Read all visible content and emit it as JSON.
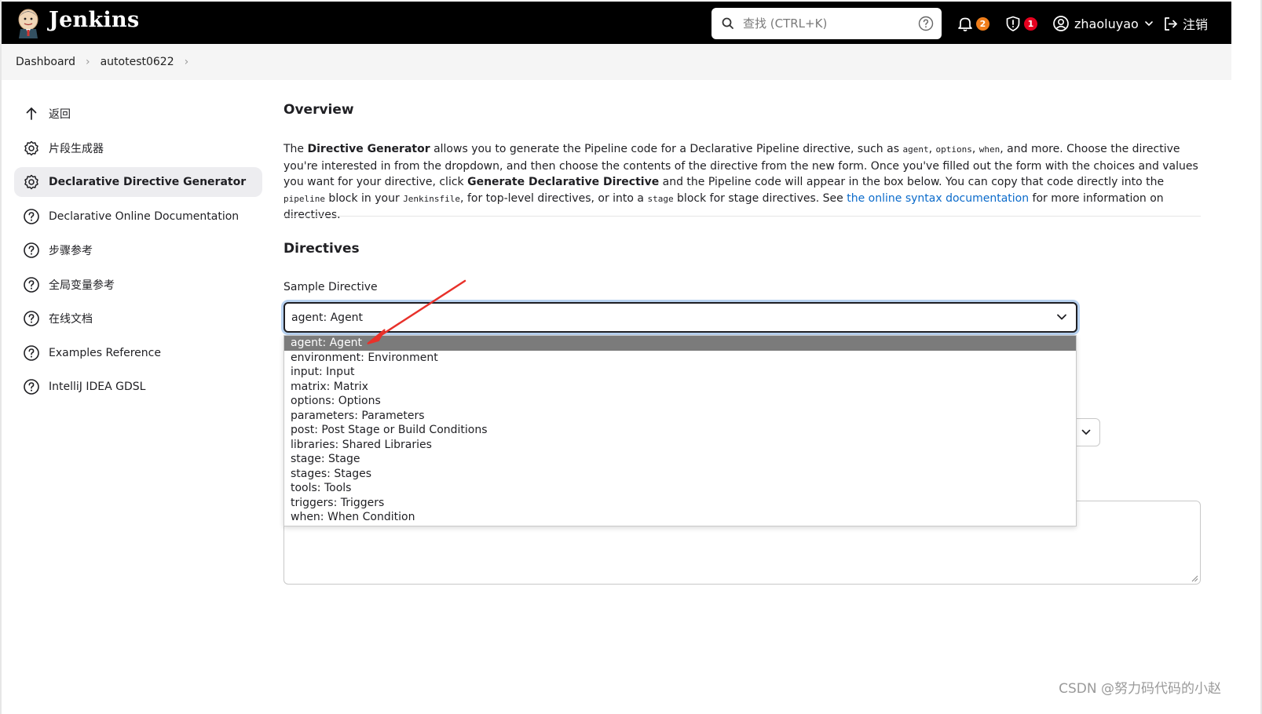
{
  "header": {
    "brand": "Jenkins",
    "search_placeholder": "查找 (CTRL+K)",
    "notifications_count": "2",
    "security_count": "1",
    "user": "zhaoluyao",
    "logout": "注销"
  },
  "breadcrumb": [
    "Dashboard",
    "autotest0622"
  ],
  "sidebar": {
    "items": [
      {
        "label": "返回",
        "icon": "arrow-up-icon"
      },
      {
        "label": "片段生成器",
        "icon": "gear-icon"
      },
      {
        "label": "Declarative Directive Generator",
        "icon": "gear-icon",
        "active": true
      },
      {
        "label": "Declarative Online Documentation",
        "icon": "help-icon"
      },
      {
        "label": "步骤参考",
        "icon": "help-icon"
      },
      {
        "label": "全局变量参考",
        "icon": "help-icon"
      },
      {
        "label": "在线文档",
        "icon": "help-icon"
      },
      {
        "label": "Examples Reference",
        "icon": "help-icon"
      },
      {
        "label": "IntelliJ IDEA GDSL",
        "icon": "help-icon"
      }
    ]
  },
  "overview": {
    "title": "Overview",
    "text_parts": {
      "p1": "The ",
      "b1": "Directive Generator",
      "p2": " allows you to generate the Pipeline code for a Declarative Pipeline directive, such as ",
      "c1": "agent",
      "p3": ", ",
      "c2": "options",
      "p4": ", ",
      "c3": "when",
      "p5": ", and more. Choose the directive you're interested in from the dropdown, and then choose the contents of the directive from the new form. Once you've filled out the form with the choices and values you want for your directive, click ",
      "b2": "Generate Declarative Directive",
      "p6": " and the Pipeline code will appear in the box below. You can copy that code directly into the ",
      "c4": "pipeline",
      "p7": " block in your ",
      "c5": "Jenkinsfile",
      "p8": ", for top-level directives, or into a ",
      "c6": "stage",
      "p9": " block for stage directives. See ",
      "link": "the online syntax documentation",
      "p10": " for more information on directives."
    }
  },
  "directives": {
    "title": "Directives",
    "field_label": "Sample Directive",
    "selected": "agent: Agent",
    "options": [
      "agent: Agent",
      "environment: Environment",
      "input: Input",
      "matrix: Matrix",
      "options: Options",
      "parameters: Parameters",
      "post: Post Stage or Build Conditions",
      "libraries: Shared Libraries",
      "stage: Stage",
      "stages: Stages",
      "tools: Tools",
      "triggers: Triggers",
      "when: When Condition"
    ]
  },
  "colors": {
    "header_bg": "#000000",
    "notif_badge": "#f07e1b",
    "security_badge": "#e6001f",
    "link": "#0b6bcb",
    "focus_ring": "#b8d2f0",
    "selected_option": "#7b7b7b",
    "annotation_arrow": "#e8312a"
  },
  "watermark": "CSDN @努力码代码的小赵"
}
